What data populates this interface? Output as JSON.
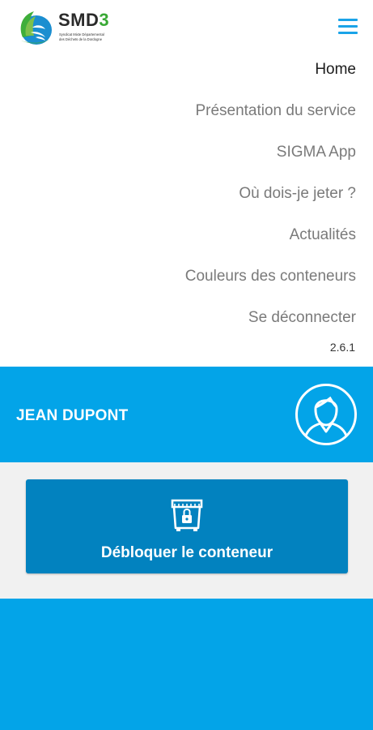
{
  "header": {
    "logo": {
      "title_letters": "SMD",
      "title_digit": "3",
      "subtitle_line1": "Syndicat Mixte Départemental",
      "subtitle_line2": "des Déchets de la Dordogne",
      "icon": "smd3-logo-icon"
    },
    "menu_icon": "hamburger-menu-icon"
  },
  "menu": {
    "items": [
      {
        "label": "Home",
        "active": true
      },
      {
        "label": "Présentation du service"
      },
      {
        "label": "SIGMA App"
      },
      {
        "label": "Où dois-je jeter ?"
      },
      {
        "label": "Actualités"
      },
      {
        "label": "Couleurs des conteneurs"
      },
      {
        "label": "Se déconnecter"
      }
    ],
    "version": "2.6.1"
  },
  "profile": {
    "name": "JEAN DUPONT",
    "avatar_icon": "user-avatar-icon"
  },
  "actions": {
    "unlock_label": "Débloquer le conteneur",
    "unlock_icon": "container-lock-icon"
  },
  "colors": {
    "primary": "#03a4e8",
    "button": "#0282bf",
    "menu_text": "#7a7a7a",
    "active_text": "#1c1c1c",
    "logo_green": "#39a935",
    "action_bg": "#f1f1f1"
  }
}
